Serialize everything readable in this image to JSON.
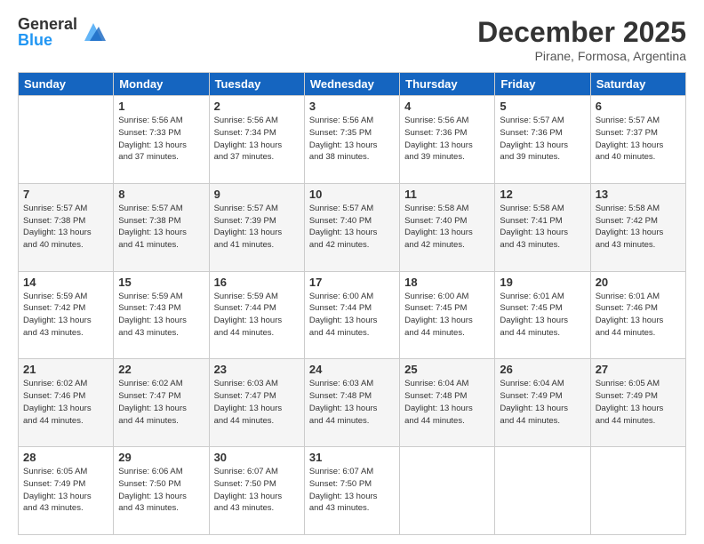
{
  "logo": {
    "general": "General",
    "blue": "Blue"
  },
  "header": {
    "month": "December 2025",
    "location": "Pirane, Formosa, Argentina"
  },
  "weekdays": [
    "Sunday",
    "Monday",
    "Tuesday",
    "Wednesday",
    "Thursday",
    "Friday",
    "Saturday"
  ],
  "weeks": [
    [
      {
        "day": "",
        "info": ""
      },
      {
        "day": "1",
        "info": "Sunrise: 5:56 AM\nSunset: 7:33 PM\nDaylight: 13 hours\nand 37 minutes."
      },
      {
        "day": "2",
        "info": "Sunrise: 5:56 AM\nSunset: 7:34 PM\nDaylight: 13 hours\nand 37 minutes."
      },
      {
        "day": "3",
        "info": "Sunrise: 5:56 AM\nSunset: 7:35 PM\nDaylight: 13 hours\nand 38 minutes."
      },
      {
        "day": "4",
        "info": "Sunrise: 5:56 AM\nSunset: 7:36 PM\nDaylight: 13 hours\nand 39 minutes."
      },
      {
        "day": "5",
        "info": "Sunrise: 5:57 AM\nSunset: 7:36 PM\nDaylight: 13 hours\nand 39 minutes."
      },
      {
        "day": "6",
        "info": "Sunrise: 5:57 AM\nSunset: 7:37 PM\nDaylight: 13 hours\nand 40 minutes."
      }
    ],
    [
      {
        "day": "7",
        "info": "Sunrise: 5:57 AM\nSunset: 7:38 PM\nDaylight: 13 hours\nand 40 minutes."
      },
      {
        "day": "8",
        "info": "Sunrise: 5:57 AM\nSunset: 7:38 PM\nDaylight: 13 hours\nand 41 minutes."
      },
      {
        "day": "9",
        "info": "Sunrise: 5:57 AM\nSunset: 7:39 PM\nDaylight: 13 hours\nand 41 minutes."
      },
      {
        "day": "10",
        "info": "Sunrise: 5:57 AM\nSunset: 7:40 PM\nDaylight: 13 hours\nand 42 minutes."
      },
      {
        "day": "11",
        "info": "Sunrise: 5:58 AM\nSunset: 7:40 PM\nDaylight: 13 hours\nand 42 minutes."
      },
      {
        "day": "12",
        "info": "Sunrise: 5:58 AM\nSunset: 7:41 PM\nDaylight: 13 hours\nand 43 minutes."
      },
      {
        "day": "13",
        "info": "Sunrise: 5:58 AM\nSunset: 7:42 PM\nDaylight: 13 hours\nand 43 minutes."
      }
    ],
    [
      {
        "day": "14",
        "info": "Sunrise: 5:59 AM\nSunset: 7:42 PM\nDaylight: 13 hours\nand 43 minutes."
      },
      {
        "day": "15",
        "info": "Sunrise: 5:59 AM\nSunset: 7:43 PM\nDaylight: 13 hours\nand 43 minutes."
      },
      {
        "day": "16",
        "info": "Sunrise: 5:59 AM\nSunset: 7:44 PM\nDaylight: 13 hours\nand 44 minutes."
      },
      {
        "day": "17",
        "info": "Sunrise: 6:00 AM\nSunset: 7:44 PM\nDaylight: 13 hours\nand 44 minutes."
      },
      {
        "day": "18",
        "info": "Sunrise: 6:00 AM\nSunset: 7:45 PM\nDaylight: 13 hours\nand 44 minutes."
      },
      {
        "day": "19",
        "info": "Sunrise: 6:01 AM\nSunset: 7:45 PM\nDaylight: 13 hours\nand 44 minutes."
      },
      {
        "day": "20",
        "info": "Sunrise: 6:01 AM\nSunset: 7:46 PM\nDaylight: 13 hours\nand 44 minutes."
      }
    ],
    [
      {
        "day": "21",
        "info": "Sunrise: 6:02 AM\nSunset: 7:46 PM\nDaylight: 13 hours\nand 44 minutes."
      },
      {
        "day": "22",
        "info": "Sunrise: 6:02 AM\nSunset: 7:47 PM\nDaylight: 13 hours\nand 44 minutes."
      },
      {
        "day": "23",
        "info": "Sunrise: 6:03 AM\nSunset: 7:47 PM\nDaylight: 13 hours\nand 44 minutes."
      },
      {
        "day": "24",
        "info": "Sunrise: 6:03 AM\nSunset: 7:48 PM\nDaylight: 13 hours\nand 44 minutes."
      },
      {
        "day": "25",
        "info": "Sunrise: 6:04 AM\nSunset: 7:48 PM\nDaylight: 13 hours\nand 44 minutes."
      },
      {
        "day": "26",
        "info": "Sunrise: 6:04 AM\nSunset: 7:49 PM\nDaylight: 13 hours\nand 44 minutes."
      },
      {
        "day": "27",
        "info": "Sunrise: 6:05 AM\nSunset: 7:49 PM\nDaylight: 13 hours\nand 44 minutes."
      }
    ],
    [
      {
        "day": "28",
        "info": "Sunrise: 6:05 AM\nSunset: 7:49 PM\nDaylight: 13 hours\nand 43 minutes."
      },
      {
        "day": "29",
        "info": "Sunrise: 6:06 AM\nSunset: 7:50 PM\nDaylight: 13 hours\nand 43 minutes."
      },
      {
        "day": "30",
        "info": "Sunrise: 6:07 AM\nSunset: 7:50 PM\nDaylight: 13 hours\nand 43 minutes."
      },
      {
        "day": "31",
        "info": "Sunrise: 6:07 AM\nSunset: 7:50 PM\nDaylight: 13 hours\nand 43 minutes."
      },
      {
        "day": "",
        "info": ""
      },
      {
        "day": "",
        "info": ""
      },
      {
        "day": "",
        "info": ""
      }
    ]
  ]
}
